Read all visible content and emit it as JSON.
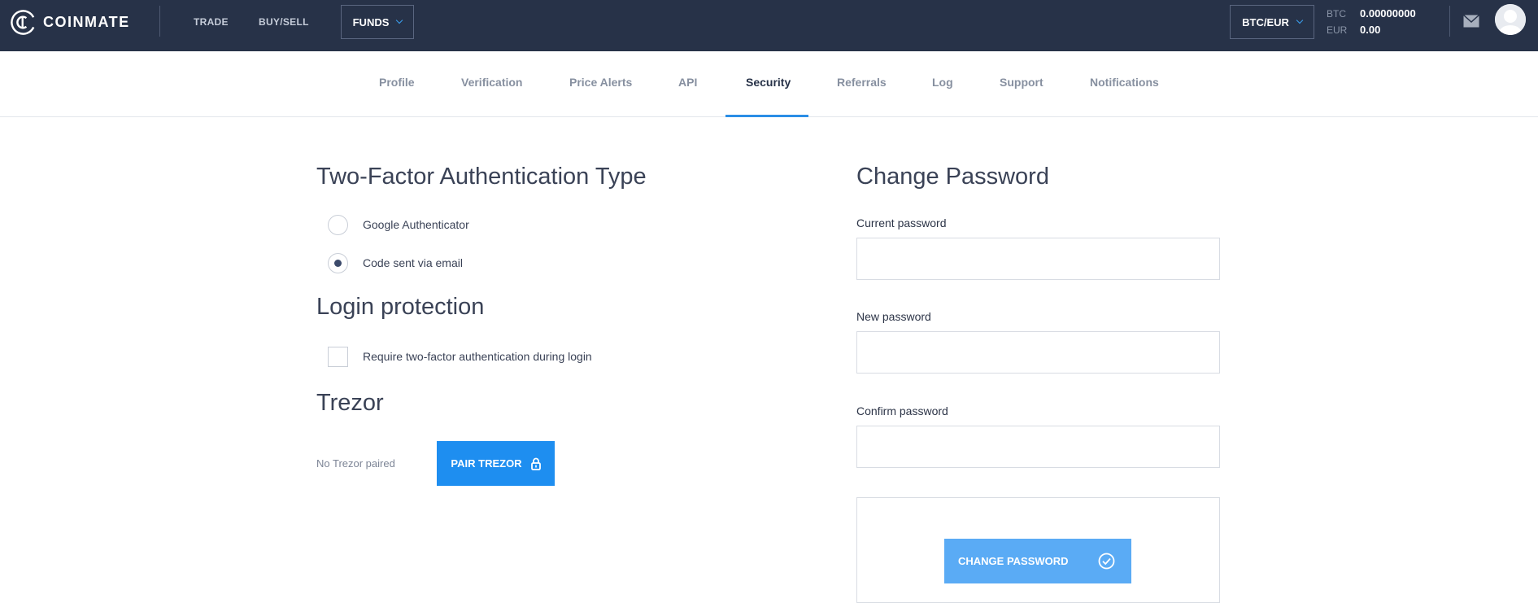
{
  "brand": {
    "name": "COINMATE"
  },
  "topnav": {
    "trade": "TRADE",
    "buysell": "BUY/SELL",
    "funds": "FUNDS",
    "pair": "BTC/EUR"
  },
  "balances": [
    {
      "currency": "BTC",
      "amount": "0.00000000"
    },
    {
      "currency": "EUR",
      "amount": "0.00"
    }
  ],
  "tabs": [
    {
      "label": "Profile",
      "active": false
    },
    {
      "label": "Verification",
      "active": false
    },
    {
      "label": "Price Alerts",
      "active": false
    },
    {
      "label": "API",
      "active": false
    },
    {
      "label": "Security",
      "active": true
    },
    {
      "label": "Referrals",
      "active": false
    },
    {
      "label": "Log",
      "active": false
    },
    {
      "label": "Support",
      "active": false
    },
    {
      "label": "Notifications",
      "active": false
    }
  ],
  "twofa": {
    "title": "Two-Factor Authentication Type",
    "options": [
      {
        "label": "Google Authenticator",
        "selected": false
      },
      {
        "label": "Code sent via email",
        "selected": true
      }
    ]
  },
  "login_protection": {
    "title": "Login protection",
    "checkbox_label": "Require two-factor authentication during login",
    "checked": false
  },
  "trezor": {
    "title": "Trezor",
    "status": "No Trezor paired",
    "button": "PAIR TREZOR"
  },
  "change_password": {
    "title": "Change Password",
    "current_label": "Current password",
    "current_value": "",
    "new_label": "New password",
    "new_value": "",
    "confirm_label": "Confirm password",
    "confirm_value": "",
    "button": "CHANGE PASSWORD"
  },
  "colors": {
    "topbar": "#273248",
    "accent": "#1e8ef0",
    "accent_light": "#5aabf5",
    "tab_active": "#273248"
  }
}
